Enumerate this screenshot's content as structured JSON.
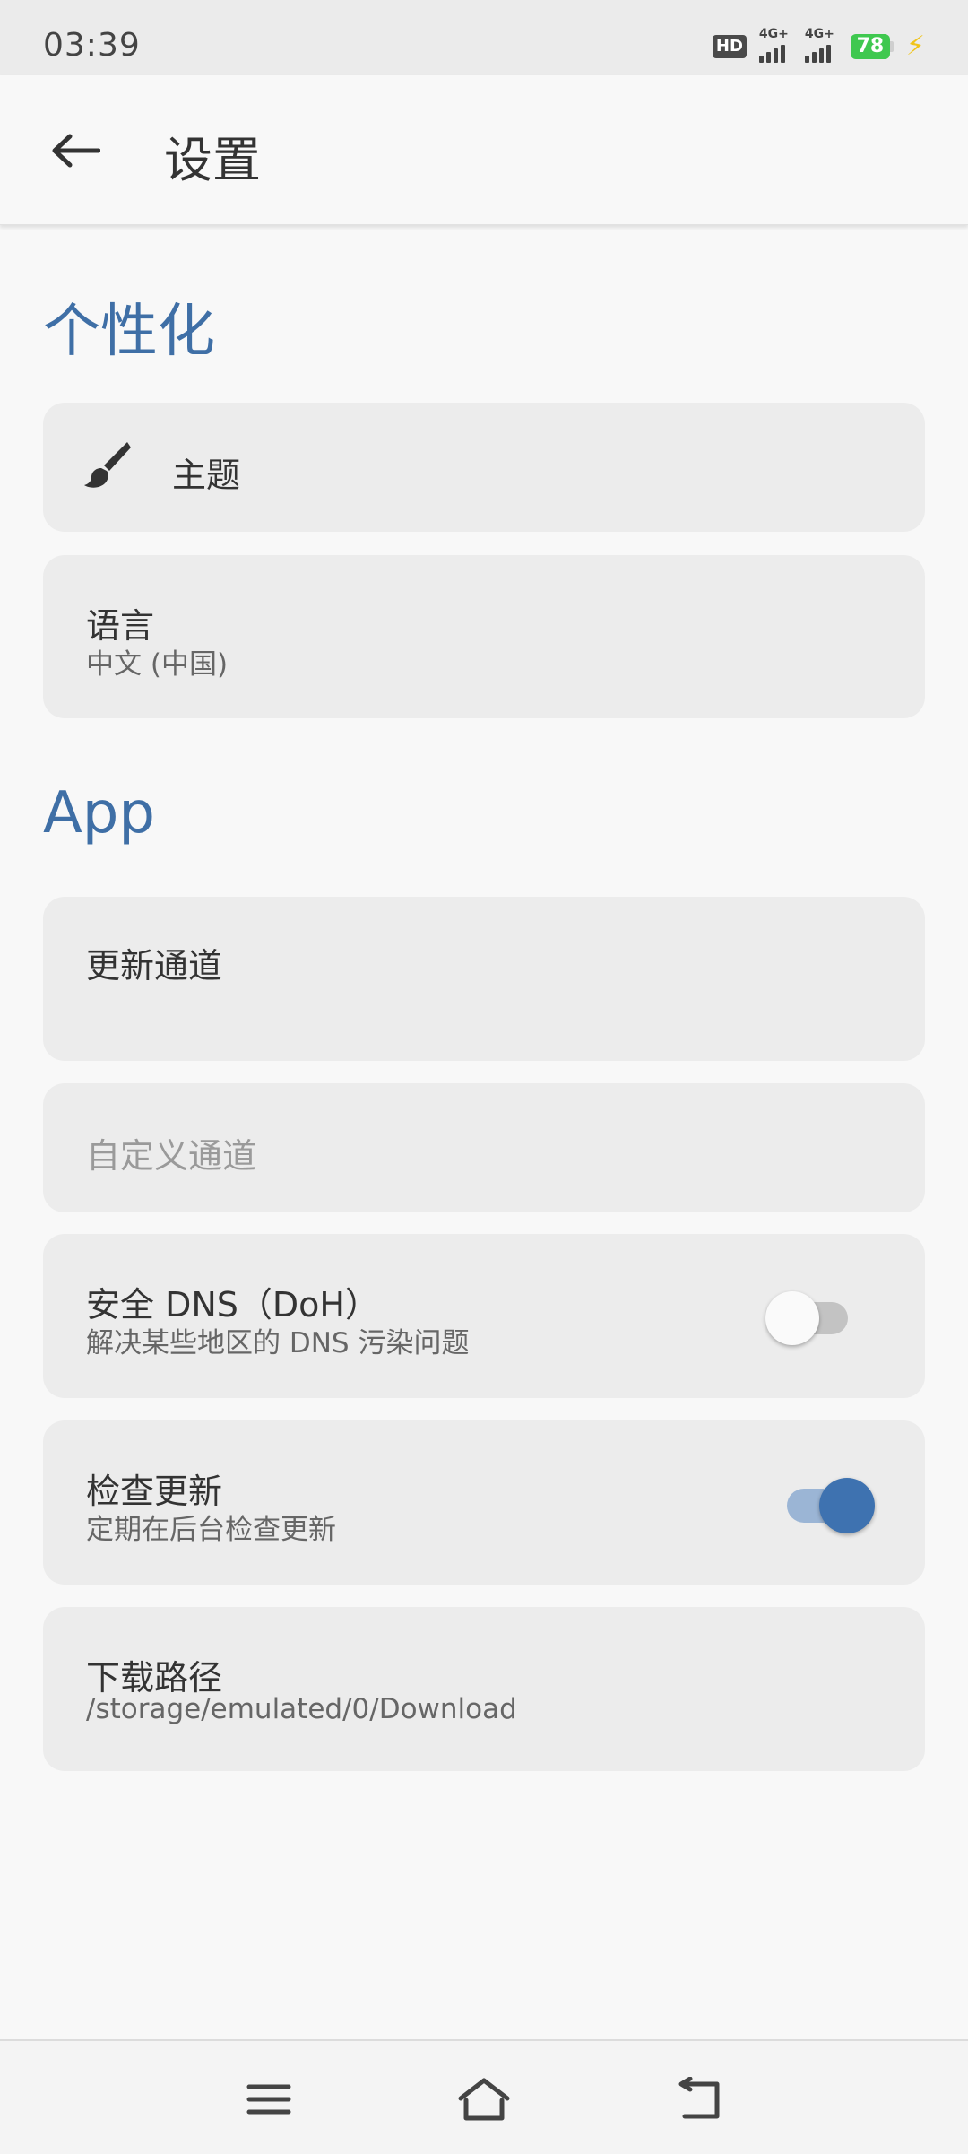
{
  "status_bar": {
    "time": "03:39",
    "hd_label": "HD",
    "network_1": "4G+",
    "network_2": "4G+",
    "battery": "78"
  },
  "app_bar": {
    "title": "设置",
    "back_icon": "arrow-left-icon"
  },
  "sections": {
    "personalization": {
      "header": "个性化",
      "theme": {
        "title": "主题",
        "icon": "brush-icon"
      },
      "language": {
        "title": "语言",
        "subtitle": "中文 (中国)"
      }
    },
    "app": {
      "header": "App",
      "update_channel": {
        "title": "更新通道"
      },
      "custom_channel": {
        "placeholder": "自定义通道"
      },
      "secure_dns": {
        "title": "安全 DNS（DoH）",
        "subtitle": "解决某些地区的 DNS 污染问题",
        "enabled": false
      },
      "check_updates": {
        "title": "检查更新",
        "subtitle": "定期在后台检查更新",
        "enabled": true
      },
      "download_path": {
        "title": "下载路径",
        "subtitle": "/storage/emulated/0/Download"
      }
    }
  },
  "colors": {
    "accent": "#3f6fa6",
    "switch_on": "#3e72b0",
    "card_bg": "#ececec",
    "battery": "#3fc84f"
  },
  "nav_bar": {
    "menu_icon": "menu-icon",
    "home_icon": "home-icon",
    "back_icon": "back-icon"
  }
}
